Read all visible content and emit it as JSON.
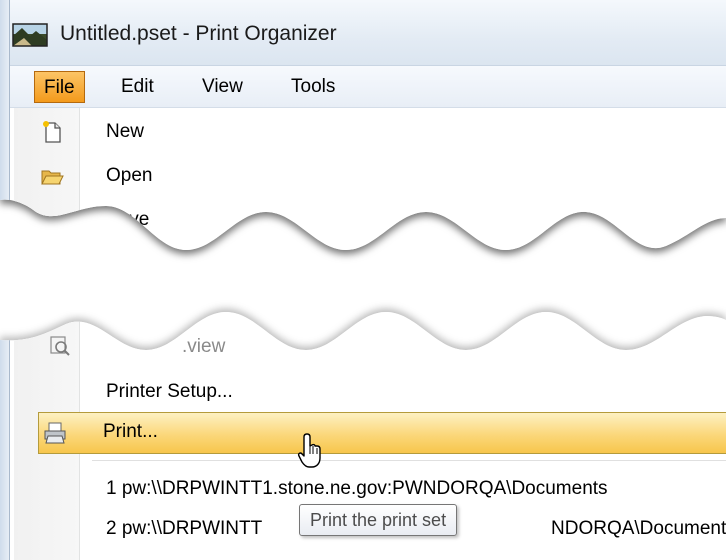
{
  "window": {
    "title": "Untitled.pset - Print Organizer",
    "app_icon": "print-organizer-icon"
  },
  "menubar": {
    "items": [
      {
        "label": "File",
        "active": true
      },
      {
        "label": "Edit"
      },
      {
        "label": "View"
      },
      {
        "label": "Tools"
      }
    ]
  },
  "file_menu_top": {
    "items": [
      {
        "label": "New",
        "icon": "new-document-icon"
      },
      {
        "label": "Open",
        "icon": "open-folder-icon"
      },
      {
        "label": "Save"
      }
    ]
  },
  "file_menu_bottom": {
    "items": [
      {
        "label": ".view",
        "icon": "print-preview-icon"
      },
      {
        "label": "Printer Setup..."
      },
      {
        "label": "Print...",
        "icon": "printer-icon",
        "highlighted": true
      }
    ],
    "recent_files": [
      "1 pw:\\\\DRPWINTT1.stone.ne.gov:PWNDORQA\\Documents",
      "2 pw:\\\\DRPWINTT",
      "NDORQA\\Documents"
    ]
  },
  "tooltip": {
    "text": "Print the print set"
  },
  "colors": {
    "menu_active": "#f7a334",
    "highlight": "#fbd77a",
    "titlebar": "#e3ebf4"
  }
}
